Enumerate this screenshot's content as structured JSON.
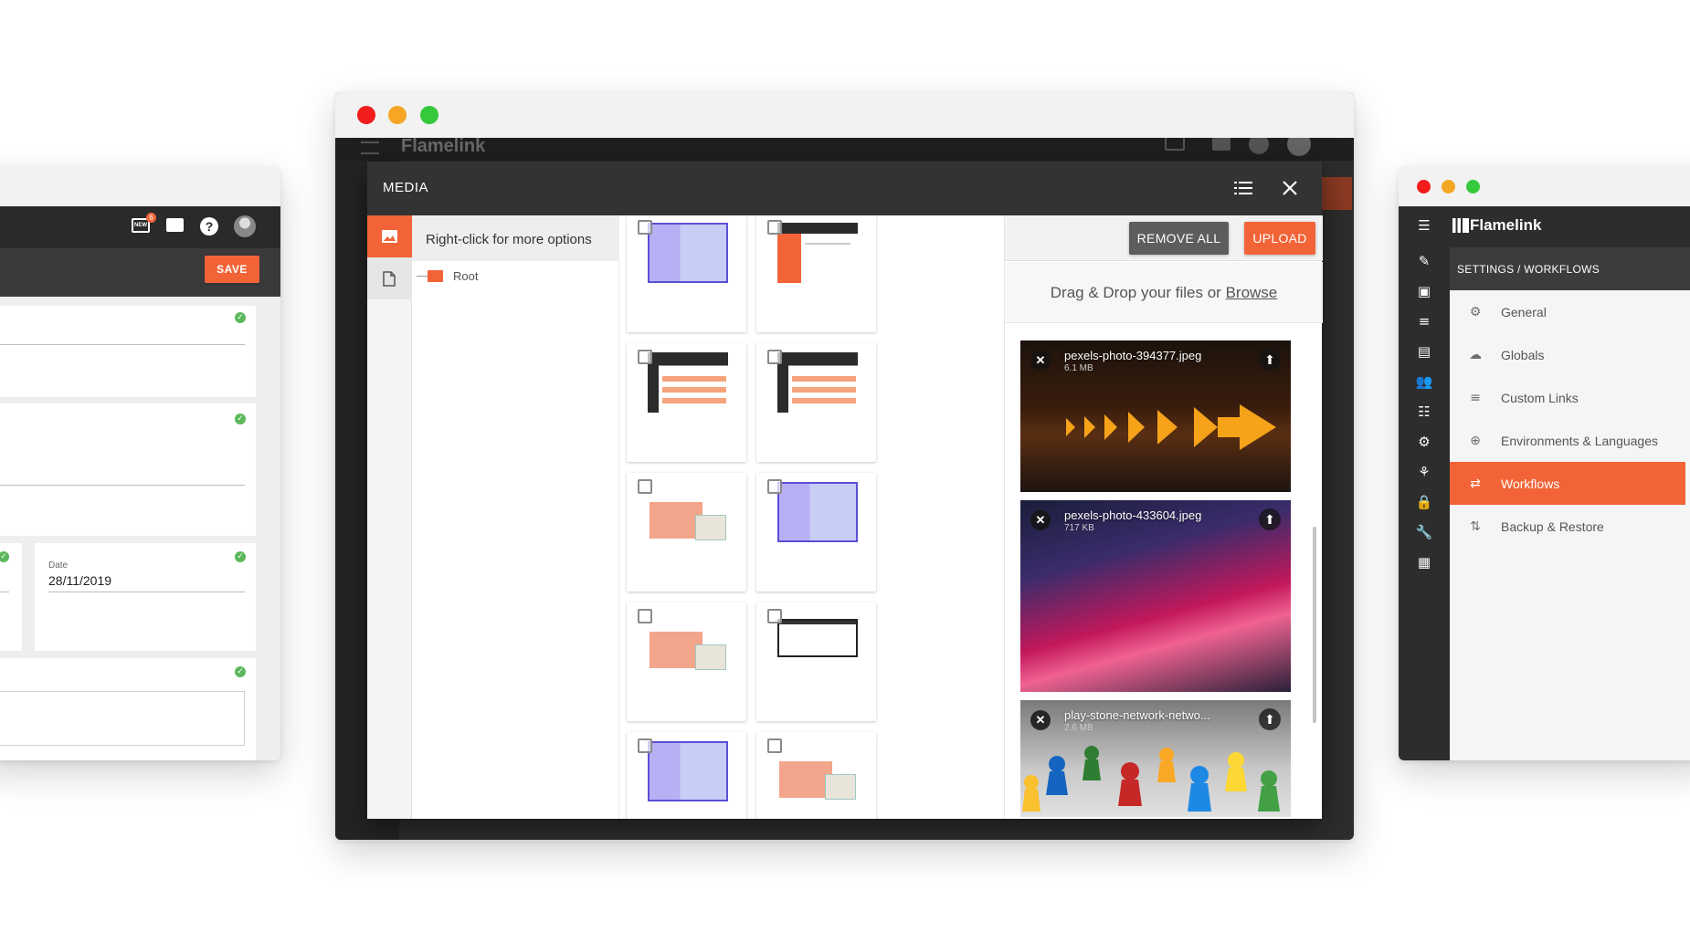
{
  "colors": {
    "accent": "#f26437",
    "dark": "#2d2d2d",
    "success": "#5cb85c"
  },
  "left_window": {
    "save_label": "SAVE",
    "notification_count": "6",
    "date_field": {
      "label": "Date",
      "value": "28/11/2019"
    }
  },
  "main_window": {
    "app_title": "Flamelink",
    "modal": {
      "title": "MEDIA",
      "tree_hint": "Right-click for more options",
      "root_folder": "Root",
      "remove_all_label": "REMOVE ALL",
      "upload_label": "UPLOAD",
      "dropzone_text": "Drag & Drop your files or",
      "dropzone_link": "Browse",
      "files": [
        {
          "name": "pexels-photo-394377.jpeg",
          "size": "6.1 MB"
        },
        {
          "name": "pexels-photo-433604.jpeg",
          "size": "717 KB"
        },
        {
          "name": "play-stone-network-netwo...",
          "size": "2.6 MB"
        }
      ]
    }
  },
  "right_window": {
    "app_title": "Flamelink",
    "breadcrumb": "SETTINGS / WORKFLOWS",
    "menu": [
      {
        "label": "General",
        "icon": "gear-icon"
      },
      {
        "label": "Globals",
        "icon": "cloud-icon"
      },
      {
        "label": "Custom Links",
        "icon": "list-icon"
      },
      {
        "label": "Environments & Languages",
        "icon": "globe-icon"
      },
      {
        "label": "Workflows",
        "icon": "workflow-icon"
      },
      {
        "label": "Backup & Restore",
        "icon": "backup-icon"
      }
    ]
  }
}
